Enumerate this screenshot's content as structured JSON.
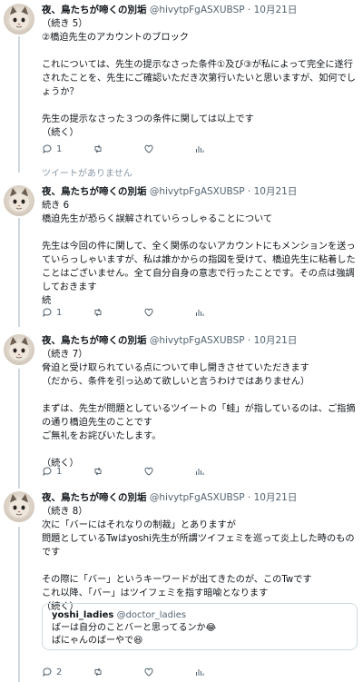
{
  "author": {
    "name": "夜、鳥たちが啼くの別垢",
    "handle": "@hivytpFgASXUBSP",
    "separator": "·",
    "date": "10月21日"
  },
  "tweets": [
    {
      "body": "（続き 5）\n②橋迫先生のアカウントのブロック\n\nこれについては、先生の提示なさった条件①及び③が私によって完全に遂行されたことを、先生にご確認いただき次第行いたいと思いますが、如何でしょうか？\n\n先生の提示なさった３つの条件に関しては以上です\n（続く）",
      "replies": "1",
      "retweets": "",
      "likes": ""
    },
    {
      "body": "続き 6\n橋迫先生が恐らく誤解されていらっしゃることについて\n\n先生は今回の件に関して、全く関係のないアカウントにもメンションを送っていらっしゃいますが、私は誰かからの指図を受けて、橋迫先生に粘着したことはございません。全て自分自身の意志で行ったことです。その点は強調しておきます\n続",
      "replies": "1",
      "retweets": "",
      "likes": ""
    },
    {
      "body": "（続き 7）\n脅迫と受け取られている点について申し開きさせていただきます\n（だから、条件を引っ込めて欲しいと言うわけではありません）\n\nまずは、先生が問題としているツイートの「蛙」が指しているのは、ご指摘の通り橋迫先生のことです\nご無礼をお詫びいたします。\n\n（続く）",
      "replies": "1",
      "retweets": "",
      "likes": ""
    },
    {
      "body": "（続き 8）\n次に「バーにはそれなりの制裁」とありますが\n問題としているTwはyoshi先生が所謂ツイフェミを巡って炎上した時のものです\n\nその際に「バー」というキーワードが出てきたのが、このTwです\nこれ以降、「バー」はツイフェミを指す暗喩となります\n（続く）",
      "replies": "2",
      "retweets": "",
      "likes": ""
    }
  ],
  "unavailable_text": "ツイートがありません",
  "quote": {
    "name": "yoshi_ladies",
    "handle": "@doctor_ladies",
    "body": "ばーは自分のことバーと思ってるンか😂\nばにゃんのばーやで😆"
  },
  "icons": [
    "reply-icon",
    "retweet-icon",
    "like-icon",
    "analytics-icon"
  ],
  "colors": {
    "text": "#0f1419",
    "secondary": "#536471",
    "thread_line": "#cfd9de",
    "background": "#ffffff"
  }
}
